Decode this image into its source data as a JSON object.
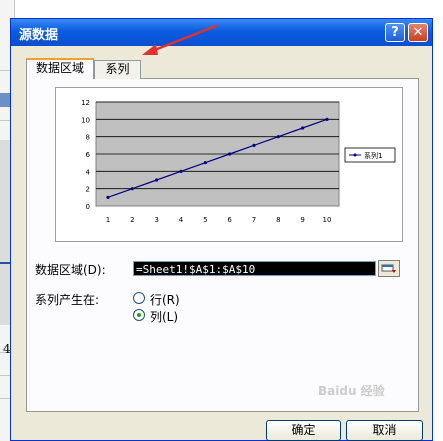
{
  "window": {
    "title": "源数据",
    "help_label": "?",
    "close_label": "✕"
  },
  "tabs": [
    {
      "label": "数据区域",
      "active": true
    },
    {
      "label": "系列",
      "active": false
    }
  ],
  "chart_data": {
    "type": "line",
    "x": [
      1,
      2,
      3,
      4,
      5,
      6,
      7,
      8,
      9,
      10
    ],
    "series": [
      {
        "name": "系列1",
        "values": [
          1,
          2,
          3,
          4,
          5,
          6,
          7,
          8,
          9,
          10
        ]
      }
    ],
    "y_ticks": [
      "0",
      "2",
      "4",
      "6",
      "8",
      "10",
      "12"
    ],
    "x_ticks": [
      "1",
      "2",
      "3",
      "4",
      "5",
      "6",
      "7",
      "8",
      "9",
      "10"
    ],
    "ylim": [
      0,
      12
    ],
    "grid": true,
    "legend": "right",
    "colors": {
      "plot_bg": "#c0c0c0",
      "series": "#000080"
    }
  },
  "data_range": {
    "label": "数据区域(D):",
    "value": "=Sheet1!$A$1:$A$10"
  },
  "series_in": {
    "label": "系列产生在:",
    "options": [
      {
        "label": "行(R)",
        "selected": false
      },
      {
        "label": "列(L)",
        "selected": true
      }
    ]
  },
  "buttons": {
    "ok": "确定",
    "cancel": "取消"
  },
  "background": {
    "cell_text": "4"
  },
  "watermark": "Baidu 经验"
}
